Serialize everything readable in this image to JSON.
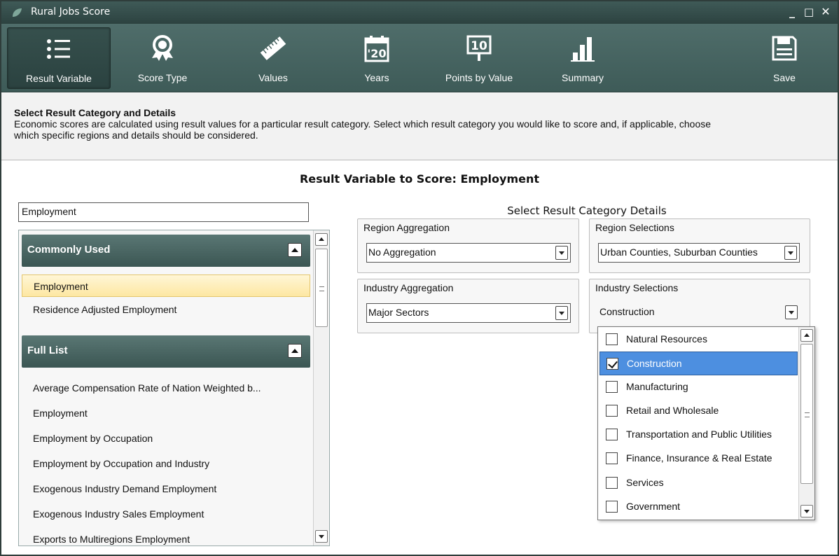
{
  "window": {
    "title": "Rural Jobs Score",
    "controls": {
      "minimize": "_",
      "maximize": "□",
      "close": "✕"
    }
  },
  "toolbar": {
    "items": [
      {
        "label": "Result Variable",
        "icon": "list-icon",
        "active": true
      },
      {
        "label": "Score Type",
        "icon": "award-ribbon-icon",
        "active": false
      },
      {
        "label": "Values",
        "icon": "ruler-icon",
        "active": false
      },
      {
        "label": "Years",
        "icon": "calendar-icon",
        "icon_text": "'20",
        "active": false
      },
      {
        "label": "Points by Value",
        "icon": "signboard-icon",
        "icon_text": "10",
        "active": false
      },
      {
        "label": "Summary",
        "icon": "bar-chart-icon",
        "active": false
      },
      {
        "label": "Save",
        "icon": "save-icon",
        "active": false
      }
    ]
  },
  "instructions": {
    "heading": "Select Result Category and Details",
    "line1": "Economic scores are calculated using result values for a particular result category. Select which result category you would like to score and, if applicable, choose",
    "line2": "which  specific regions and details should be considered."
  },
  "main": {
    "title": "Result Variable to Score: Employment"
  },
  "search": {
    "value": "Employment"
  },
  "list": {
    "commonly_used": {
      "header": "Commonly Used",
      "items": [
        {
          "label": "Employment",
          "selected": true
        },
        {
          "label": "Residence Adjusted Employment",
          "selected": false
        }
      ]
    },
    "full_list": {
      "header": "Full List",
      "items": [
        "Average Compensation Rate of Nation Weighted b...",
        "Employment",
        "Employment by Occupation",
        "Employment by Occupation and Industry",
        "Exogenous Industry Demand Employment",
        "Exogenous Industry Sales Employment",
        "Exports to Multiregions Employment"
      ]
    }
  },
  "details": {
    "title": "Select Result Category Details",
    "region_aggregation": {
      "label": "Region Aggregation",
      "value": "No Aggregation"
    },
    "region_selections": {
      "label": "Region Selections",
      "value": "Urban Counties, Suburban Counties"
    },
    "industry_aggregation": {
      "label": "Industry Aggregation",
      "value": "Major Sectors"
    },
    "industry_selections": {
      "label": "Industry Selections",
      "value": "Construction",
      "options": [
        {
          "label": "Natural Resources",
          "checked": false
        },
        {
          "label": "Construction",
          "checked": true
        },
        {
          "label": "Manufacturing",
          "checked": false
        },
        {
          "label": "Retail and Wholesale",
          "checked": false
        },
        {
          "label": "Transportation and Public Utilities",
          "checked": false
        },
        {
          "label": "Finance, Insurance & Real Estate",
          "checked": false
        },
        {
          "label": "Services",
          "checked": false
        },
        {
          "label": "Government",
          "checked": false
        }
      ]
    }
  },
  "colors": {
    "toolbar": "#46625f",
    "titlebar": "#2f4644",
    "group_header": "#4a6663",
    "selected_list": "#fde7a2",
    "selected_option": "#4d8fe0"
  }
}
